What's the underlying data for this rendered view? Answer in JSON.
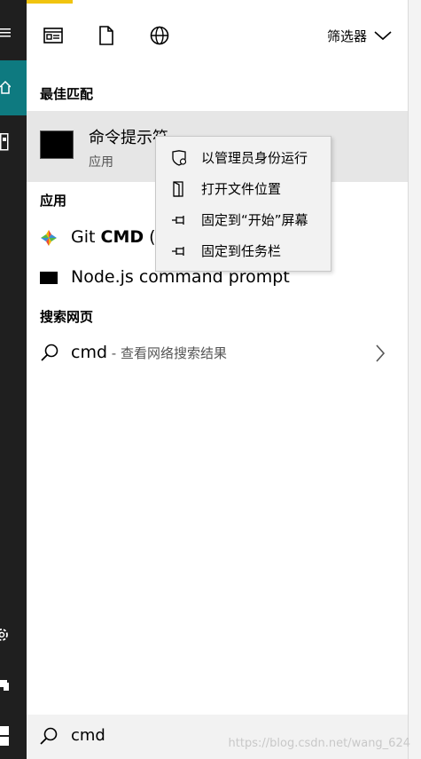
{
  "taskbar": {
    "menu_glyph": "≡",
    "home_glyph": "⌂",
    "doc_glyph": "▢",
    "settings_glyph": "⚙",
    "power_glyph": "⬡"
  },
  "toolbar": {
    "icons": [
      "app-window-icon",
      "document-icon",
      "globe-icon"
    ],
    "filter_label": "筛选器"
  },
  "sections": {
    "best_match_title": "最佳匹配",
    "apps_title": "应用",
    "web_title": "搜索网页"
  },
  "best_match": {
    "name": "命令提示符",
    "type": "应用"
  },
  "apps": [
    {
      "label": "Git CMD (D",
      "icon": "git-icon"
    },
    {
      "label": "Node.js command prompt",
      "icon": "terminal-icon"
    }
  ],
  "web": {
    "query": "cmd",
    "suffix": " - 查看网络搜索结果"
  },
  "context_menu": {
    "items": [
      {
        "label": "以管理员身份运行",
        "icon": "shield-icon"
      },
      {
        "label": "打开文件位置",
        "icon": "folder-open-icon"
      },
      {
        "label": "固定到“开始”屏幕",
        "icon": "pin-icon"
      },
      {
        "label": "固定到任务栏",
        "icon": "pin-icon"
      }
    ]
  },
  "search": {
    "value": "cmd"
  },
  "watermark": "https://blog.csdn.net/wang_624",
  "colors": {
    "accent": "#0e7a80",
    "taskbar": "#1f1f1f",
    "highlight": "#e6e6e6"
  }
}
